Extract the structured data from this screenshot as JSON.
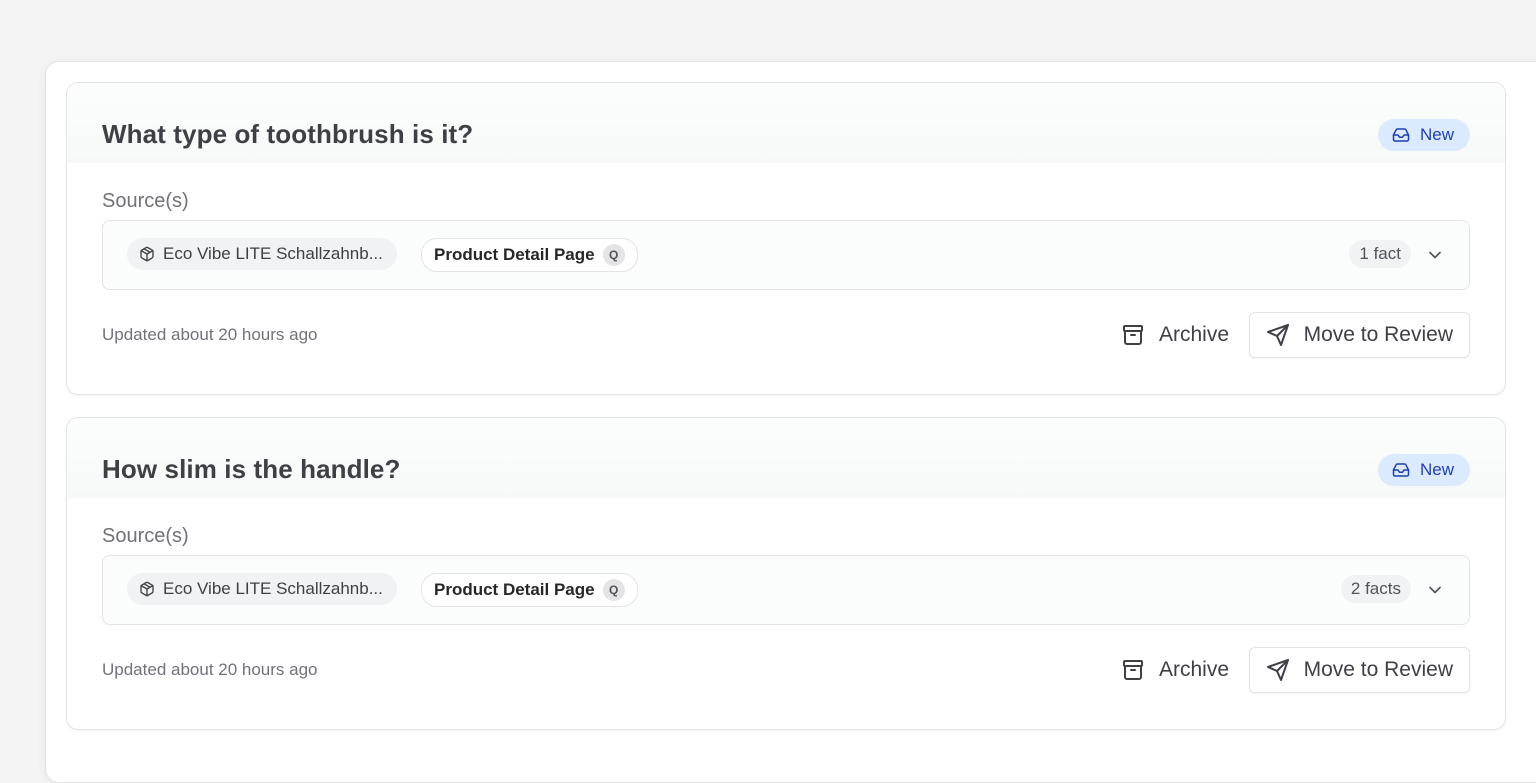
{
  "questions": [
    {
      "title": "What type of toothbrush is it?",
      "status": "New",
      "sources_label": "Source(s)",
      "product_chip": "Eco Vibe LITE Schallzahnb...",
      "page_chip": "Product Detail Page",
      "page_chip_badge": "Q",
      "facts": "1 fact",
      "updated": "Updated about 20 hours ago",
      "archive_label": "Archive",
      "review_label": "Move to Review"
    },
    {
      "title": "How slim is the handle?",
      "status": "New",
      "sources_label": "Source(s)",
      "product_chip": "Eco Vibe LITE Schallzahnb...",
      "page_chip": "Product Detail Page",
      "page_chip_badge": "Q",
      "facts": "2 facts",
      "updated": "Updated about 20 hours ago",
      "archive_label": "Archive",
      "review_label": "Move to Review"
    }
  ],
  "icons": {
    "status": "inbox-icon",
    "product": "package-icon",
    "expand": "chevron-down-icon",
    "archive": "archive-icon",
    "review": "send-icon"
  },
  "colors": {
    "badge_bg": "#dbeafe",
    "badge_text": "#1e40af"
  }
}
